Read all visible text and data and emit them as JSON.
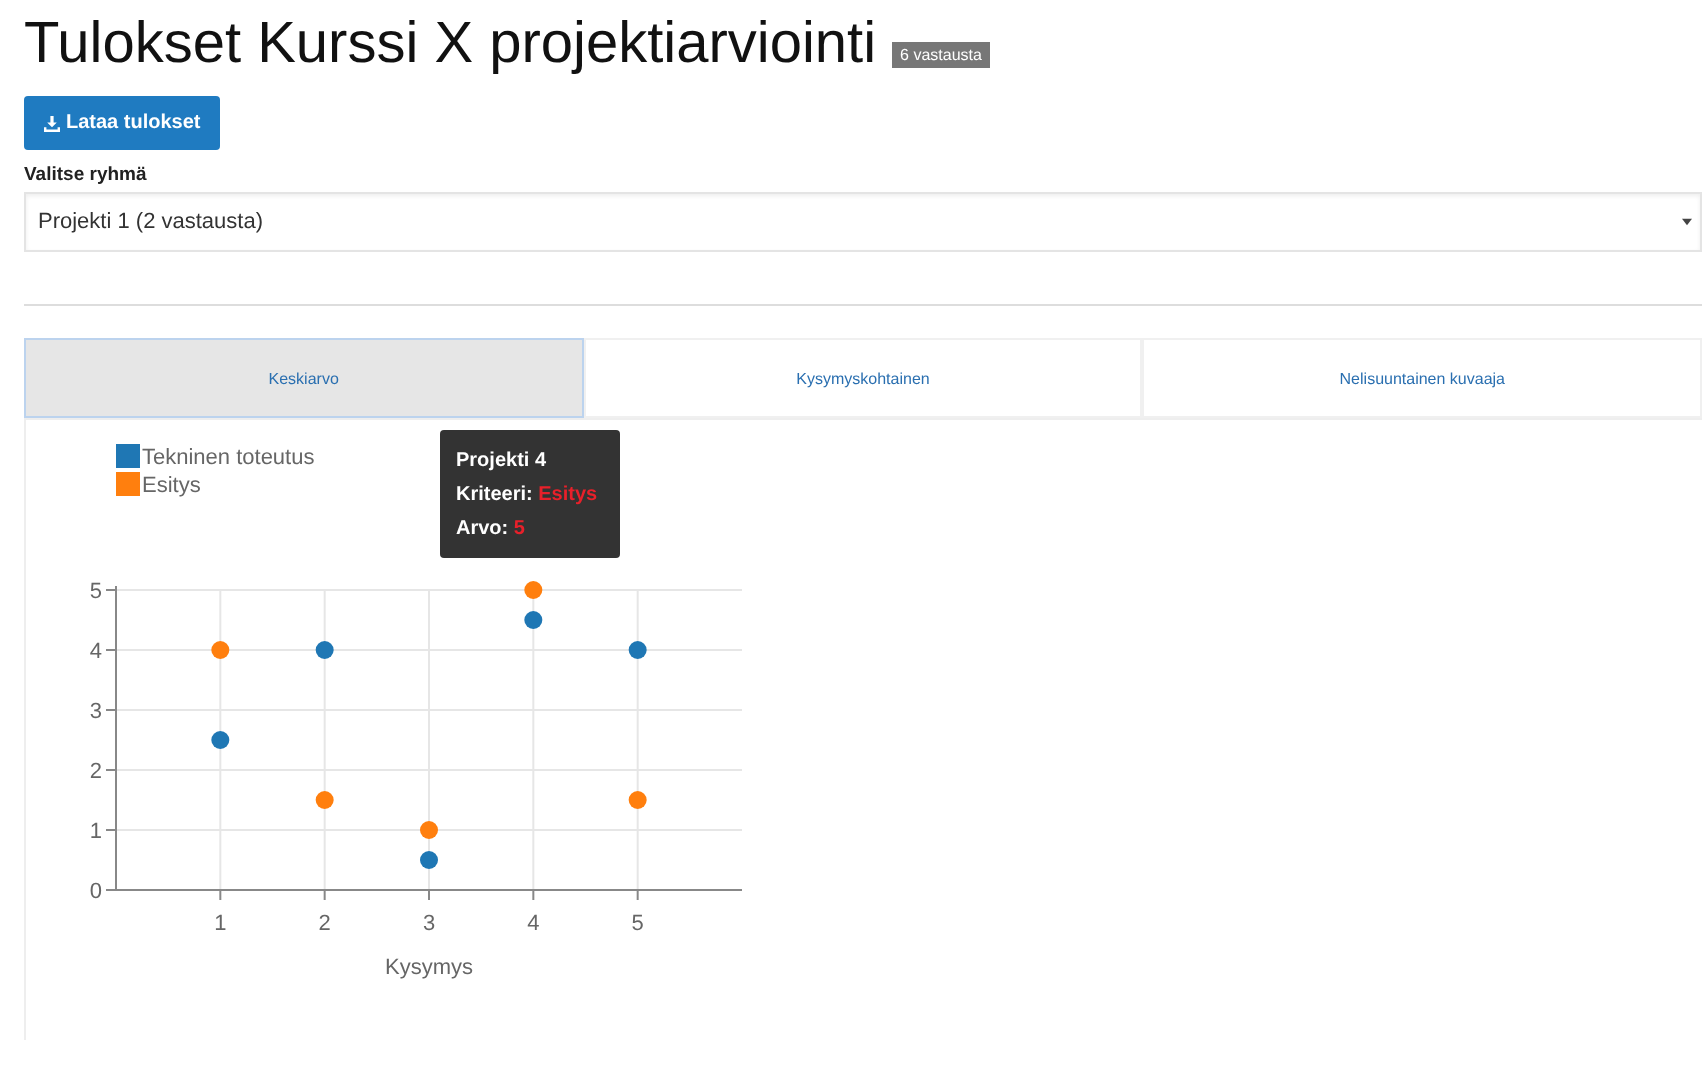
{
  "title": "Tulokset Kurssi X projektiarviointi",
  "count_badge": "6 vastausta",
  "download_button": {
    "label": "Lataa tulokset"
  },
  "group_select": {
    "label": "Valitse ryhmä",
    "value": "Projekti 1 (2 vastausta)"
  },
  "tabs": [
    {
      "label": "Keskiarvo",
      "selected": true
    },
    {
      "label": "Kysymyskohtainen",
      "selected": false
    },
    {
      "label": "Nelisuuntainen kuvaaja",
      "selected": false
    }
  ],
  "chart": {
    "chart_data": {
      "type": "scatter",
      "xlabel": "Kysymys",
      "x": [
        1,
        2,
        3,
        4,
        5
      ],
      "xlim": [
        0,
        6
      ],
      "ylim": [
        0,
        5
      ],
      "xticks": [
        1,
        2,
        3,
        4,
        5
      ],
      "grid": true,
      "legend": true,
      "yticks": [
        0,
        1,
        2,
        3,
        4,
        5
      ],
      "series": [
        {
          "name": "Tekninen toteutus",
          "color": "#1f77b4",
          "values": [
            2.5,
            4,
            0.5,
            4.5,
            4
          ]
        },
        {
          "name": "Esitys",
          "color": "#ff7f0e",
          "values": [
            4,
            1.5,
            1,
            5,
            1.5
          ]
        }
      ]
    },
    "tooltip": {
      "title": "Projekti 4",
      "rows": [
        {
          "label": "Kriteeri:",
          "value": "Esitys"
        },
        {
          "label": "Arvo:",
          "value": "5"
        }
      ]
    }
  }
}
